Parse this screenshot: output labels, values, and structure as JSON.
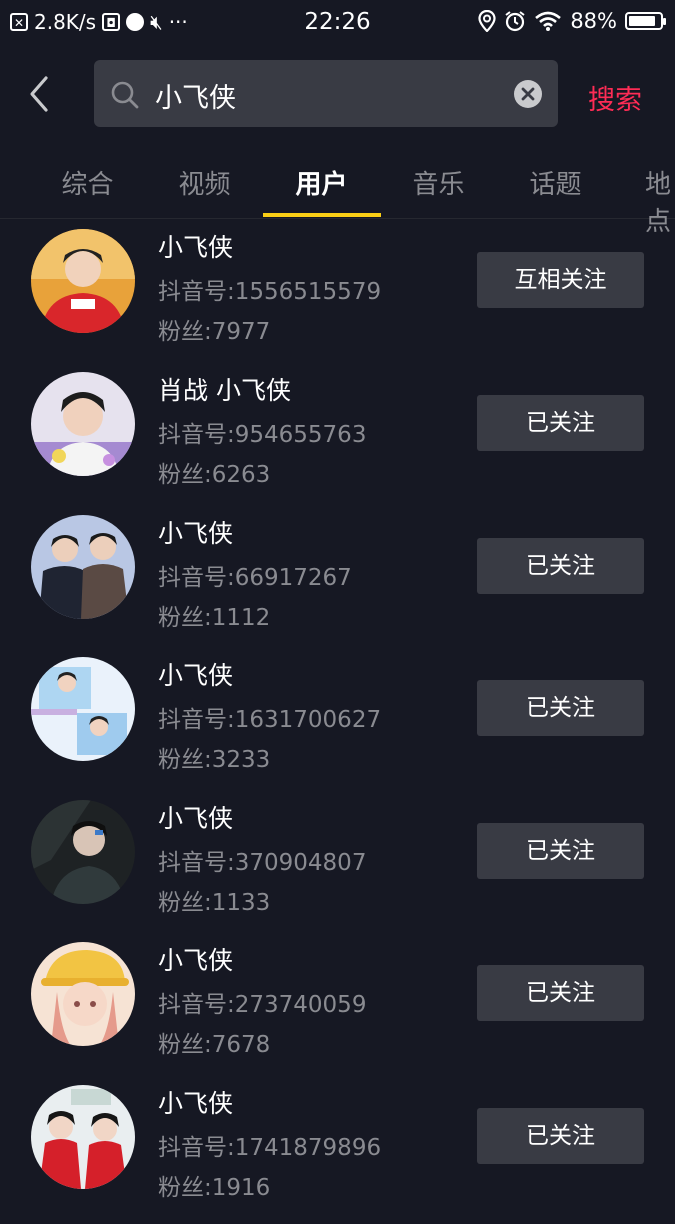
{
  "status_bar": {
    "network_speed": "2.8K/s",
    "time": "22:26",
    "battery": "88%",
    "battery_level": 0.88
  },
  "search": {
    "query": "小飞侠",
    "button_label": "搜索"
  },
  "tabs": [
    {
      "label": "综合",
      "active": false
    },
    {
      "label": "视频",
      "active": false
    },
    {
      "label": "用户",
      "active": true
    },
    {
      "label": "音乐",
      "active": false
    },
    {
      "label": "话题",
      "active": false
    },
    {
      "label": "地点",
      "active": false
    }
  ],
  "users": [
    {
      "name": "小飞侠",
      "douyin_id": "抖音号:1556515579",
      "fans": "粉丝:7977",
      "button": "互相关注"
    },
    {
      "name": "肖战 小飞侠",
      "douyin_id": "抖音号:954655763",
      "fans": "粉丝:6263",
      "button": "已关注"
    },
    {
      "name": "小飞侠",
      "douyin_id": "抖音号:66917267",
      "fans": "粉丝:1112",
      "button": "已关注"
    },
    {
      "name": "小飞侠",
      "douyin_id": "抖音号:1631700627",
      "fans": "粉丝:3233",
      "button": "已关注"
    },
    {
      "name": "小飞侠",
      "douyin_id": "抖音号:370904807",
      "fans": "粉丝:1133",
      "button": "已关注"
    },
    {
      "name": "小飞侠",
      "douyin_id": "抖音号:273740059",
      "fans": "粉丝:7678",
      "button": "已关注"
    },
    {
      "name": "小飞侠",
      "douyin_id": "抖音号:1741879896",
      "fans": "粉丝:1916",
      "button": "已关注"
    }
  ],
  "colors": {
    "background": "#161823",
    "accent_red": "#fe2c55",
    "tab_underline": "#face15",
    "button_bg": "#393b44",
    "secondary_text": "#8a8b91"
  }
}
